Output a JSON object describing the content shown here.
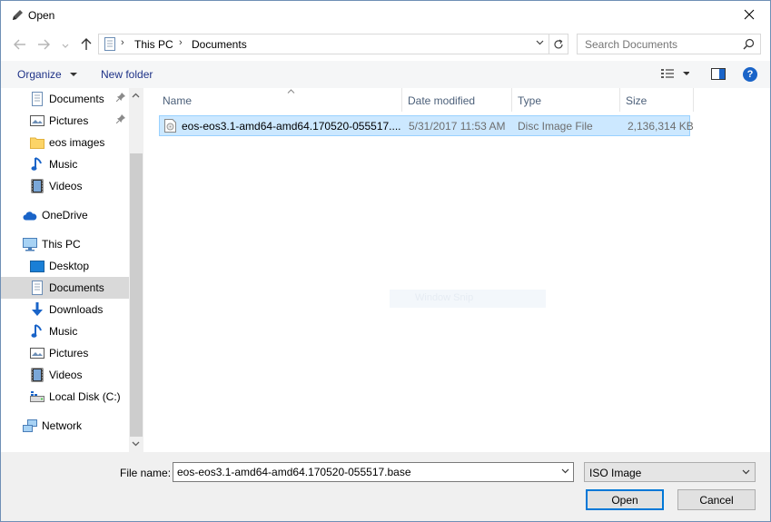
{
  "window": {
    "title": "Open"
  },
  "address": {
    "crumbs": [
      "This PC",
      "Documents"
    ]
  },
  "search": {
    "placeholder": "Search Documents"
  },
  "toolbar": {
    "organize": "Organize",
    "new_folder": "New folder",
    "help": "?"
  },
  "nav": {
    "quick_access": [
      {
        "label": "Documents",
        "icon": "documents-icon",
        "pinned": true
      },
      {
        "label": "Pictures",
        "icon": "pictures-icon",
        "pinned": true
      },
      {
        "label": "eos images",
        "icon": "folder-icon",
        "pinned": false
      },
      {
        "label": "Music",
        "icon": "music-icon",
        "pinned": false
      },
      {
        "label": "Videos",
        "icon": "videos-icon",
        "pinned": false
      }
    ],
    "onedrive": "OneDrive",
    "this_pc": "This PC",
    "this_pc_items": [
      {
        "label": "Desktop",
        "icon": "desktop-icon"
      },
      {
        "label": "Documents",
        "icon": "documents-icon",
        "selected": true
      },
      {
        "label": "Downloads",
        "icon": "downloads-icon"
      },
      {
        "label": "Music",
        "icon": "music-icon"
      },
      {
        "label": "Pictures",
        "icon": "pictures-icon"
      },
      {
        "label": "Videos",
        "icon": "videos-icon"
      },
      {
        "label": "Local Disk (C:)",
        "icon": "local-disk-icon"
      }
    ],
    "network": "Network"
  },
  "columns": {
    "name": "Name",
    "date_modified": "Date modified",
    "type": "Type",
    "size": "Size"
  },
  "files": [
    {
      "name": "eos-eos3.1-amd64-amd64.170520-055517....",
      "date_modified": "5/31/2017 11:53 AM",
      "type": "Disc Image File",
      "size": "2,136,314 KB"
    }
  ],
  "bottom": {
    "file_name_label": "File name:",
    "file_name_value": "eos-eos3.1-amd64-amd64.170520-055517.base",
    "filter": "ISO Image",
    "open": "Open",
    "cancel": "Cancel"
  },
  "watermark": "Window Snip",
  "colors": {
    "selection_bg": "#cce8ff",
    "selection_border": "#99d1ff",
    "accent": "#0078d7",
    "link_text": "#1e3287"
  }
}
